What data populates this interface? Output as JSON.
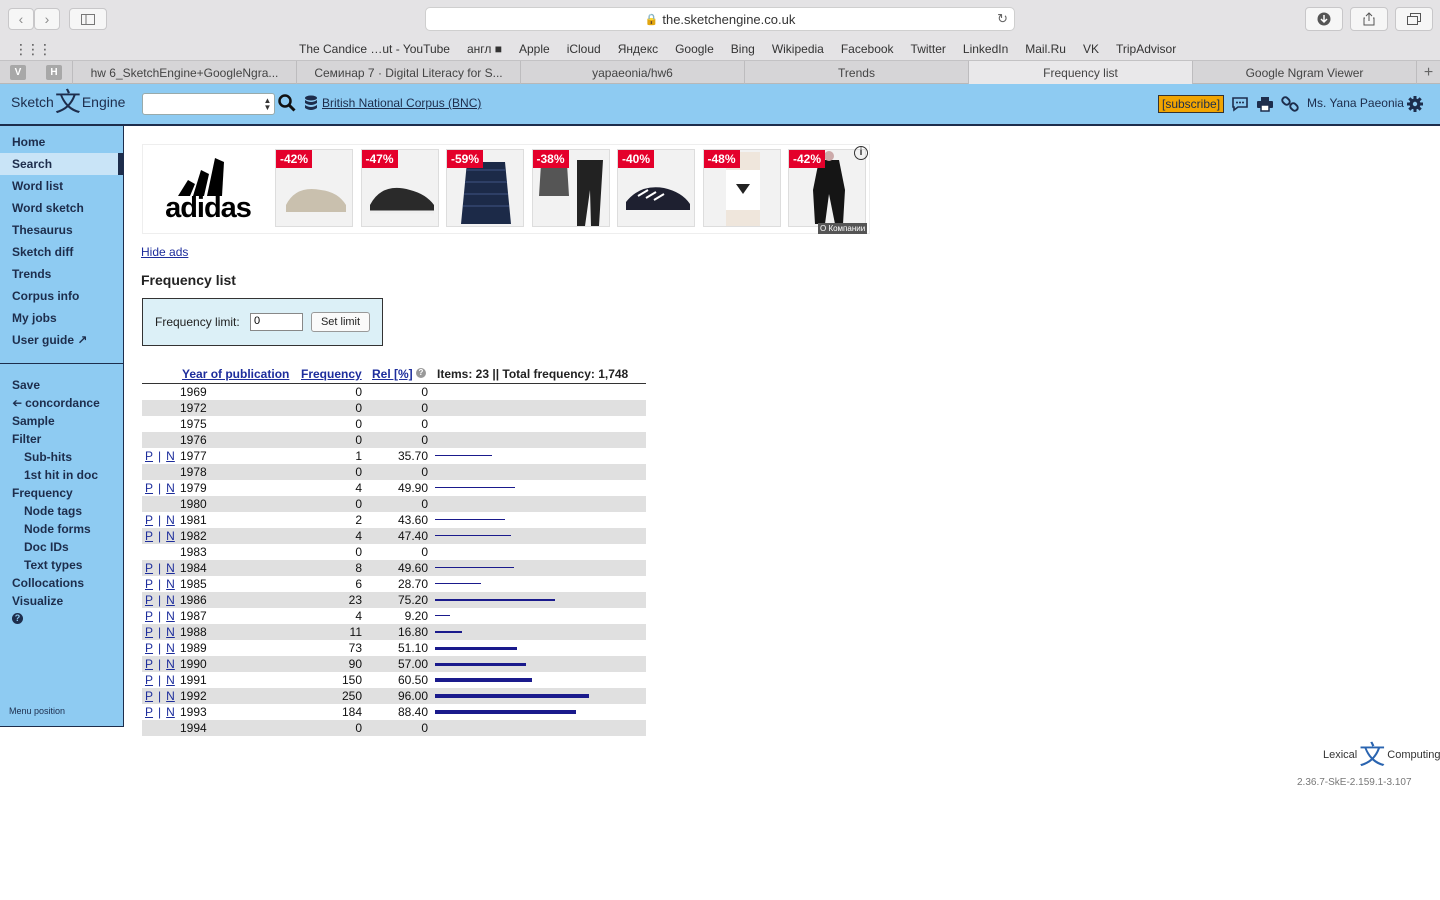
{
  "browser": {
    "url": "the.sketchengine.co.uk",
    "bookmarks": [
      "The Candice …ut - YouTube",
      "англ ■",
      "Apple",
      "iCloud",
      "Яндекс",
      "Google",
      "Bing",
      "Wikipedia",
      "Facebook",
      "Twitter",
      "LinkedIn",
      "Mail.Ru",
      "VK",
      "TripAdvisor"
    ],
    "pinned": [
      "V",
      "H"
    ],
    "tabs": [
      {
        "label": "hw 6_SketchEngine+GoogleNgra...",
        "active": false
      },
      {
        "label": "Семинар 7 · Digital Literacy for S...",
        "active": false
      },
      {
        "label": "yapaeonia/hw6",
        "active": false
      },
      {
        "label": "Trends",
        "active": false
      },
      {
        "label": "Frequency list",
        "active": true
      },
      {
        "label": "Google Ngram Viewer",
        "active": false
      }
    ]
  },
  "header": {
    "logo_left": "Sketch",
    "logo_glyph": "文",
    "logo_right": "Engine",
    "corpus": "British National Corpus (BNC)",
    "subscribe": "[subscribe]",
    "user": "Ms. Yana Paeonia"
  },
  "sidebar": {
    "main": [
      "Home",
      "Search",
      "Word list",
      "Word sketch",
      "Thesaurus",
      "Sketch diff",
      "Trends",
      "Corpus info",
      "My jobs",
      "User guide"
    ],
    "active": "Search",
    "tools": [
      {
        "label": "Save",
        "indent": false
      },
      {
        "label": "concordance",
        "indent": false
      },
      {
        "label": "Sample",
        "indent": false
      },
      {
        "label": "Filter",
        "indent": false
      },
      {
        "label": "Sub-hits",
        "indent": true
      },
      {
        "label": "1st hit in doc",
        "indent": true
      },
      {
        "label": "Frequency",
        "indent": false
      },
      {
        "label": "Node tags",
        "indent": true
      },
      {
        "label": "Node forms",
        "indent": true
      },
      {
        "label": "Doc IDs",
        "indent": true
      },
      {
        "label": "Text types",
        "indent": true
      },
      {
        "label": "Collocations",
        "indent": false
      },
      {
        "label": "Visualize",
        "indent": false
      }
    ],
    "menu_position": "Menu position"
  },
  "ad": {
    "brand": "adidas",
    "discounts": [
      "-42%",
      "-47%",
      "-59%",
      "-38%",
      "-40%",
      "-48%",
      "-42%"
    ],
    "company": "О Компании",
    "info": "i"
  },
  "content": {
    "hide_ads": "Hide ads",
    "title": "Frequency list",
    "freq_limit_label": "Frequency limit:",
    "freq_limit_value": "0",
    "set_limit": "Set limit"
  },
  "table": {
    "col_year": "Year of publication",
    "col_freq": "Frequency",
    "col_rel": "Rel [%]",
    "summary": "Items: 23 || Total frequency: 1,748",
    "p_label": "P",
    "n_label": "N",
    "sep": "|",
    "rows": [
      {
        "year": "1969",
        "freq": "0",
        "rel": "0",
        "rel_num": 0,
        "links": false
      },
      {
        "year": "1972",
        "freq": "0",
        "rel": "0",
        "rel_num": 0,
        "links": false
      },
      {
        "year": "1975",
        "freq": "0",
        "rel": "0",
        "rel_num": 0,
        "links": false
      },
      {
        "year": "1976",
        "freq": "0",
        "rel": "0",
        "rel_num": 0,
        "links": false
      },
      {
        "year": "1977",
        "freq": "1",
        "rel": "35.70",
        "rel_num": 35.7,
        "links": true
      },
      {
        "year": "1978",
        "freq": "0",
        "rel": "0",
        "rel_num": 0,
        "links": false
      },
      {
        "year": "1979",
        "freq": "4",
        "rel": "49.90",
        "rel_num": 49.9,
        "links": true
      },
      {
        "year": "1980",
        "freq": "0",
        "rel": "0",
        "rel_num": 0,
        "links": false
      },
      {
        "year": "1981",
        "freq": "2",
        "rel": "43.60",
        "rel_num": 43.6,
        "links": true
      },
      {
        "year": "1982",
        "freq": "4",
        "rel": "47.40",
        "rel_num": 47.4,
        "links": true
      },
      {
        "year": "1983",
        "freq": "0",
        "rel": "0",
        "rel_num": 0,
        "links": false
      },
      {
        "year": "1984",
        "freq": "8",
        "rel": "49.60",
        "rel_num": 49.6,
        "links": true
      },
      {
        "year": "1985",
        "freq": "6",
        "rel": "28.70",
        "rel_num": 28.7,
        "links": true
      },
      {
        "year": "1986",
        "freq": "23",
        "rel": "75.20",
        "rel_num": 75.2,
        "links": true
      },
      {
        "year": "1987",
        "freq": "4",
        "rel": "9.20",
        "rel_num": 9.2,
        "links": true
      },
      {
        "year": "1988",
        "freq": "11",
        "rel": "16.80",
        "rel_num": 16.8,
        "links": true
      },
      {
        "year": "1989",
        "freq": "73",
        "rel": "51.10",
        "rel_num": 51.1,
        "links": true
      },
      {
        "year": "1990",
        "freq": "90",
        "rel": "57.00",
        "rel_num": 57.0,
        "links": true
      },
      {
        "year": "1991",
        "freq": "150",
        "rel": "60.50",
        "rel_num": 60.5,
        "links": true
      },
      {
        "year": "1992",
        "freq": "250",
        "rel": "96.00",
        "rel_num": 96.0,
        "links": true
      },
      {
        "year": "1993",
        "freq": "184",
        "rel": "88.40",
        "rel_num": 88.4,
        "links": true
      },
      {
        "year": "1994",
        "freq": "0",
        "rel": "0",
        "rel_num": 0,
        "links": false
      }
    ]
  },
  "footer": {
    "lexical_left": "Lexical",
    "lexical_glyph": "文",
    "lexical_right": "Computing",
    "version": "2.36.7-SkE-2.159.1-3.107"
  },
  "colors": {
    "header_bg": "#8ecbf2",
    "accent_dark": "#1d2d4c",
    "bar": "#1a1a8c",
    "discount": "#e4002b",
    "subscribe": "#f2a500"
  }
}
